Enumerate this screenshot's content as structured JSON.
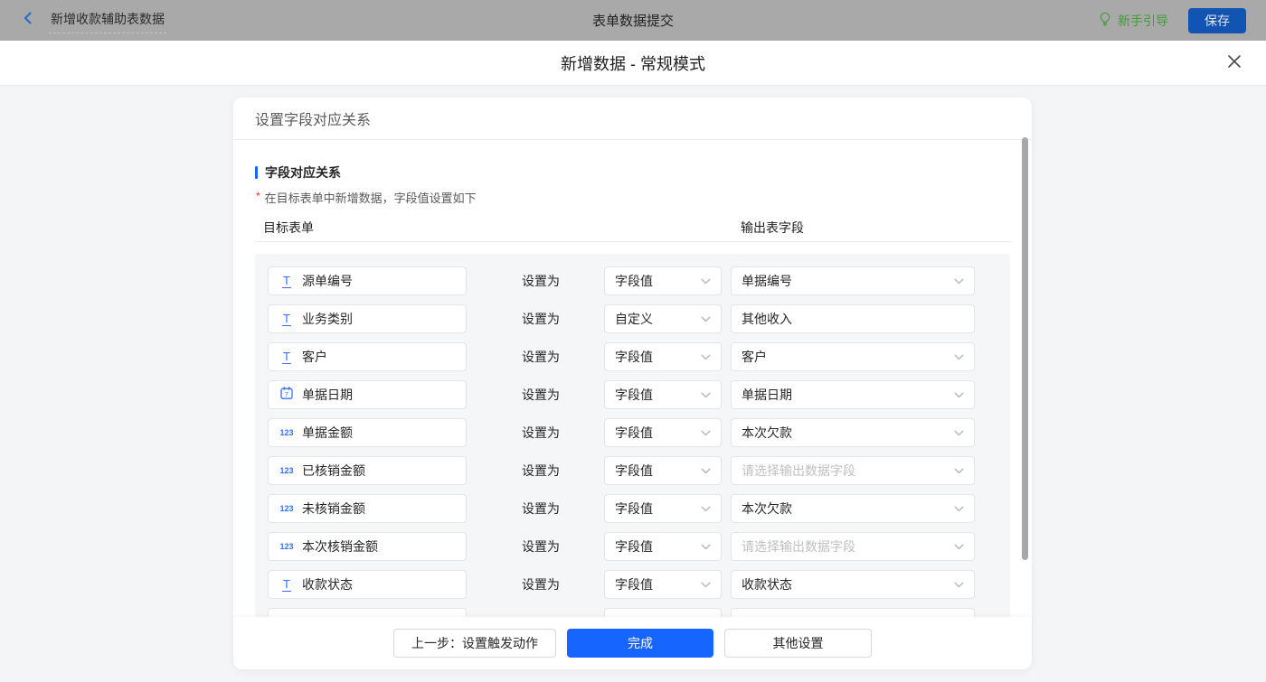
{
  "topbar": {
    "back_label": "新增收款辅助表数据",
    "center_title": "表单数据提交",
    "guide_label": "新手引导",
    "save_label": "保存"
  },
  "modal": {
    "title": "新增数据 - 常规模式"
  },
  "card": {
    "header": "设置字段对应关系",
    "section_title": "字段对应关系",
    "required_mark": "*",
    "section_desc": "在目标表单中新增数据，字段值设置如下",
    "col_left": "目标表单",
    "col_right": "输出表字段",
    "set_as_label": "设置为",
    "number_icon_text": "123",
    "text_icon_text": "T",
    "date_icon_text": "7",
    "output_placeholder": "请选择输出数据字段",
    "partial_row_visible": true,
    "rows": [
      {
        "icon": "text",
        "field": "源单编号",
        "mode": "字段值",
        "output": "单据编号",
        "output_type": "select"
      },
      {
        "icon": "text",
        "field": "业务类别",
        "mode": "自定义",
        "output": "其他收入",
        "output_type": "input"
      },
      {
        "icon": "text",
        "field": "客户",
        "mode": "字段值",
        "output": "客户",
        "output_type": "select"
      },
      {
        "icon": "date",
        "field": "单据日期",
        "mode": "字段值",
        "output": "单据日期",
        "output_type": "select"
      },
      {
        "icon": "number",
        "field": "单据金额",
        "mode": "字段值",
        "output": "本次欠款",
        "output_type": "select"
      },
      {
        "icon": "number",
        "field": "已核销金额",
        "mode": "字段值",
        "output": "",
        "output_type": "select"
      },
      {
        "icon": "number",
        "field": "未核销金额",
        "mode": "字段值",
        "output": "本次欠款",
        "output_type": "select"
      },
      {
        "icon": "number",
        "field": "本次核销金额",
        "mode": "字段值",
        "output": "",
        "output_type": "select"
      },
      {
        "icon": "text",
        "field": "收款状态",
        "mode": "字段值",
        "output": "收款状态",
        "output_type": "select"
      }
    ]
  },
  "footer": {
    "prev_label": "上一步：设置触发动作",
    "done_label": "完成",
    "other_label": "其他设置"
  },
  "colors": {
    "accent": "#1665ff",
    "field_icon_blue": "#3370ff",
    "topbar_bg": "#a9a9a9",
    "save_button_bg": "#1254b2",
    "guide_green": "#3f9e35",
    "required_red": "#f5222d",
    "placeholder_gray": "#bfbfbf",
    "panel_bg": "#f5f6f8",
    "body_bg": "#f4f5f6",
    "scrollbar_thumb": "#a8a8a8"
  }
}
